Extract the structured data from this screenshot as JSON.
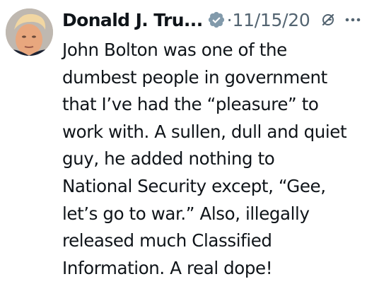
{
  "tweet": {
    "author_name": "Donald J. Tru...",
    "separator": "·",
    "date": "11/15/20",
    "text": "John Bolton was one of the\ndumbest people in government\nthat I’ve had the “pleasure” to\nwork with. A sullen, dull and quiet\nguy, he added nothing to\nNational Security except, “Gee,\nlet’s go to war.” Also, illegally\nreleased much Classified\nInformation. A real dope!"
  },
  "icons": {
    "verified": "verified-badge-icon",
    "grok": "grok-icon",
    "more": "more-options-icon"
  },
  "colors": {
    "text": "#0f1419",
    "secondary": "#536471",
    "verified_badge": "#829aab"
  }
}
